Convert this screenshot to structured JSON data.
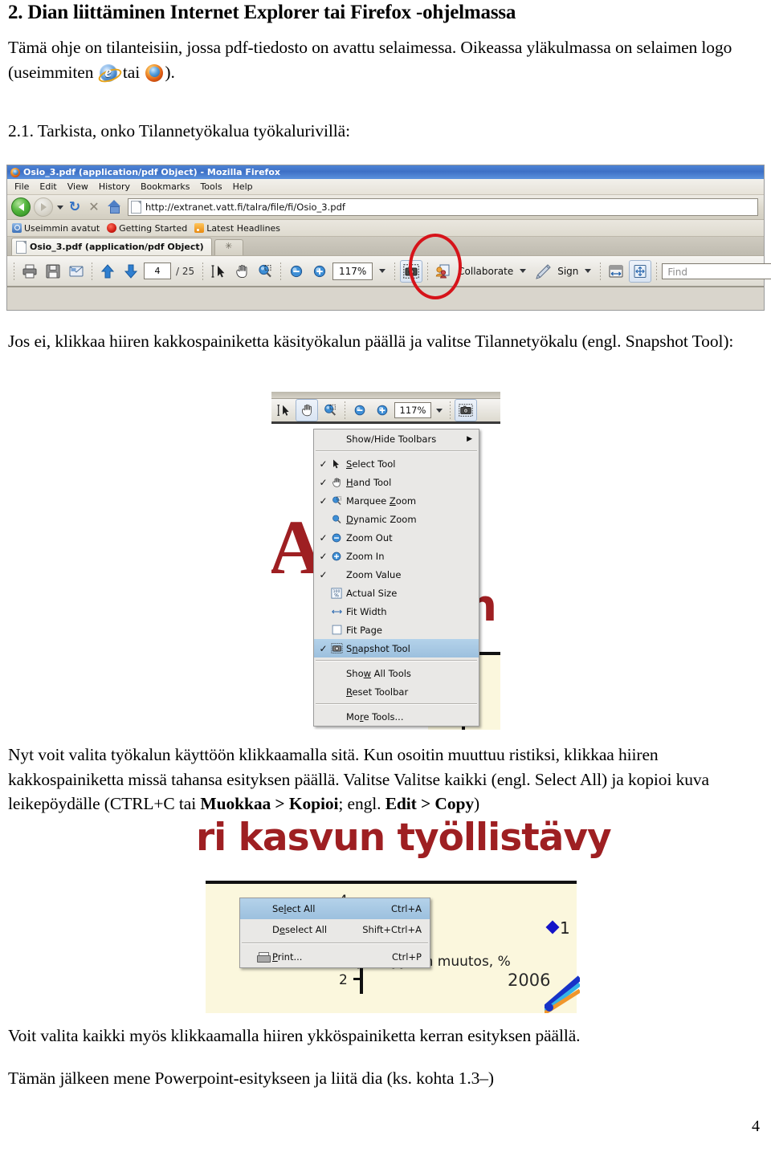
{
  "document": {
    "title": "2. Dian liittäminen Internet Explorer tai Firefox -ohjelmassa",
    "intro_part1": "Tämä ohje on tilanteisiin, jossa pdf-tiedosto on avattu selaimessa. Oikeassa yläkulmassa on selaimen logo (useimmiten ",
    "intro_tai": " tai ",
    "intro_part2": ").",
    "step_2_1": "2.1. Tarkista, onko Tilannetyökalua työkalurivillä:",
    "para_jos_ei": "Jos ei, klikkaa hiiren kakkospainiketta käsityökalun päällä ja valitse Tilannetyökalu (engl. Snapshot Tool):",
    "para_nyt_1": "Nyt voit valita työkalun käyttöön klikkaamalla sitä. Kun osoitin muuttuu ristiksi, klikkaa hiiren kakkospainiketta missä tahansa esityksen päällä. Valitse Valitse kaikki (engl. Select All) ja kopioi kuva leikepöydälle (CTRL+C tai ",
    "para_nyt_bold1": "Muokkaa > Kopioi",
    "para_nyt_mid": "; engl. ",
    "para_nyt_bold2": "Edit > Copy",
    "para_nyt_end": ")",
    "para_voit": "Voit valita kaikki myös klikkaamalla hiiren ykköspainiketta kerran esityksen päällä.",
    "para_taman": "Tämän jälkeen mene Powerpoint-esitykseen ja liitä dia (ks. kohta 1.3–)",
    "page_number": "4",
    "inline_icons": {
      "ie": "internet-explorer-logo",
      "firefox": "firefox-logo"
    }
  },
  "screenshot_firefox": {
    "window_title": "Osio_3.pdf (application/pdf Object) - Mozilla Firefox",
    "app_icon": "firefox-icon",
    "menubar": [
      "File",
      "Edit",
      "View",
      "History",
      "Bookmarks",
      "Tools",
      "Help"
    ],
    "nav": {
      "back_icon": "back-arrow-icon",
      "forward_icon": "forward-arrow-icon",
      "history_dropdown_icon": "chevron-down-icon",
      "reload_icon": "reload-icon",
      "reload_glyph": "↻",
      "stop_icon": "stop-icon",
      "stop_glyph": "✕",
      "home_icon": "home-icon"
    },
    "url": "http://extranet.vatt.fi/talra/file/fi/Osio_3.pdf",
    "url_favicon": "page-icon",
    "bookmarks": [
      {
        "label": "Useimmin avatut",
        "icon": "most-visited-icon"
      },
      {
        "label": "Getting Started",
        "icon": "getting-started-icon"
      },
      {
        "label": "Latest Headlines",
        "icon": "rss-feed-icon"
      }
    ],
    "tab": {
      "label": "Osio_3.pdf (application/pdf Object)",
      "icon": "page-icon",
      "new_tab_icon": "new-tab-icon"
    },
    "acrobat_toolbar": {
      "print_icon": "print-icon",
      "save_icon": "save-icon",
      "email_icon": "email-icon",
      "prev_page_icon": "up-arrow-icon",
      "next_page_icon": "down-arrow-icon",
      "page_value": "4",
      "page_total": "/ 25",
      "select_tool_icon": "select-tool-icon",
      "hand_tool_icon": "hand-tool-icon",
      "marquee_zoom_icon": "marquee-zoom-icon",
      "zoom_out_icon": "zoom-out-icon",
      "zoom_in_icon": "zoom-in-icon",
      "zoom_value": "117%",
      "zoom_dropdown_icon": "chevron-down-icon",
      "snapshot_tool_icon": "snapshot-tool-icon",
      "collaborate_icon": "collaborate-icon",
      "collaborate_label": "Collaborate",
      "collaborate_dropdown_icon": "chevron-down-icon",
      "sign_icon": "sign-pen-icon",
      "sign_label": "Sign",
      "sign_dropdown_icon": "chevron-down-icon",
      "fit_width_icon": "fit-width-icon",
      "fit_page_icon": "fit-page-icon",
      "find_placeholder": "Find",
      "find_dropdown_icon": "chevron-down-icon"
    },
    "annotation": {
      "shape": "red-ellipse-highlight",
      "color": "#d6131a"
    }
  },
  "screenshot_contextmenu": {
    "toolbar": {
      "select_tool_icon": "select-tool-icon",
      "hand_tool_icon": "hand-tool-icon",
      "marquee_zoom_icon": "marquee-zoom-icon",
      "zoom_out_icon": "zoom-out-icon",
      "zoom_in_icon": "zoom-in-icon",
      "zoom_value": "117%",
      "zoom_dropdown_icon": "chevron-down-icon",
      "snapshot_tool_icon": "snapshot-tool-icon"
    },
    "pdf_background": {
      "letter": "A",
      "word_fragment": "n"
    },
    "menu_items": [
      {
        "label": "Show/Hide Toolbars",
        "checked": false,
        "icon": null,
        "submenu": true,
        "selected": false
      },
      {
        "separator": true
      },
      {
        "label": "Select Tool",
        "checked": true,
        "icon": "select-tool-icon",
        "selected": false
      },
      {
        "label": "Hand Tool",
        "checked": true,
        "icon": "hand-tool-icon",
        "selected": false
      },
      {
        "label": "Marquee Zoom",
        "checked": true,
        "icon": "marquee-zoom-icon",
        "selected": false
      },
      {
        "label": "Dynamic Zoom",
        "checked": false,
        "icon": "dynamic-zoom-icon",
        "selected": false
      },
      {
        "label": "Zoom Out",
        "checked": true,
        "icon": "zoom-out-icon",
        "selected": false
      },
      {
        "label": "Zoom In",
        "checked": true,
        "icon": "zoom-in-icon",
        "selected": false
      },
      {
        "label": "Zoom Value",
        "checked": true,
        "icon": null,
        "selected": false
      },
      {
        "label": "Actual Size",
        "checked": false,
        "icon": "actual-size-icon",
        "selected": false
      },
      {
        "label": "Fit Width",
        "checked": false,
        "icon": "fit-width-icon",
        "selected": false
      },
      {
        "label": "Fit Page",
        "checked": false,
        "icon": "fit-page-icon",
        "selected": false
      },
      {
        "label": "Snapshot Tool",
        "checked": true,
        "icon": "snapshot-tool-icon",
        "selected": true
      },
      {
        "separator": true
      },
      {
        "label": "Show All Tools",
        "checked": false,
        "icon": null,
        "selected": false
      },
      {
        "label": "Reset Toolbar",
        "checked": false,
        "icon": null,
        "selected": false
      },
      {
        "separator": true
      },
      {
        "label": "More Tools...",
        "checked": false,
        "icon": null,
        "selected": false
      }
    ]
  },
  "screenshot_selectall": {
    "pdf_heading": "ri kasvun työllistävy",
    "chart_label": "Työllisyyden muutos, %",
    "axis_top": "4",
    "axis_bottom": "2",
    "data_label": "1",
    "year_label": "2006",
    "menu_items": [
      {
        "label": "Select All",
        "accel": "Ctrl+A",
        "icon": null,
        "selected": true
      },
      {
        "label": "Deselect All",
        "accel": "Shift+Ctrl+A",
        "icon": null,
        "selected": false
      },
      {
        "separator": true
      },
      {
        "label": "Print...",
        "accel": "Ctrl+P",
        "icon": "print-icon",
        "selected": false
      }
    ]
  }
}
